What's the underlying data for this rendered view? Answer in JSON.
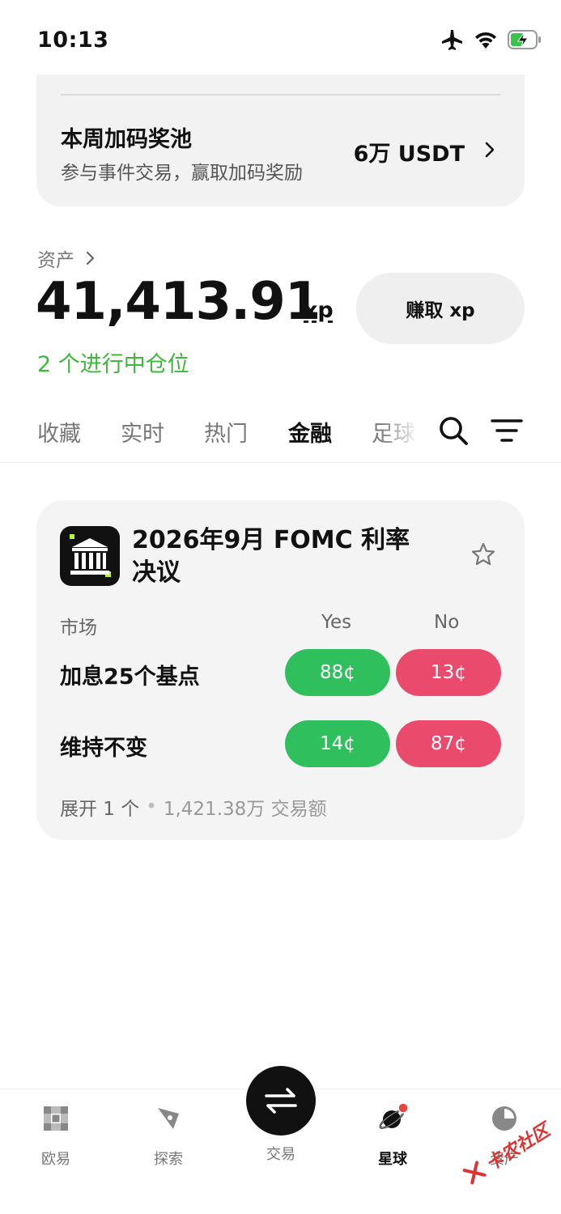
{
  "status_bar": {
    "time": "10:13"
  },
  "promo": {
    "title": "本周加码奖池",
    "subtitle": "参与事件交易，赢取加码奖励",
    "amount": "6万 USDT"
  },
  "assets": {
    "label": "资产",
    "value": "41,413.91",
    "unit": "xp",
    "earn_button": "赚取 xp",
    "positions": "2 个进行中仓位"
  },
  "tabs": [
    {
      "label": "收藏",
      "active": false
    },
    {
      "label": "实时",
      "active": false
    },
    {
      "label": "热门",
      "active": false
    },
    {
      "label": "金融",
      "active": true
    },
    {
      "label": "足球",
      "active": false
    }
  ],
  "market": {
    "title": "2026年9月 FOMC 利率决议",
    "col_market": "市场",
    "col_yes": "Yes",
    "col_no": "No",
    "rows": [
      {
        "label": "加息25个基点",
        "yes": "88¢",
        "no": "13¢"
      },
      {
        "label": "维持不变",
        "yes": "14¢",
        "no": "87¢"
      }
    ],
    "expand": "展开 1 个",
    "volume": "1,421.38万 交易额"
  },
  "bottom_nav": {
    "items": [
      {
        "label": "欧易",
        "icon": "okx-logo-icon"
      },
      {
        "label": "探索",
        "icon": "compass-icon"
      },
      {
        "label": "交易",
        "icon": "swap-arrows-icon"
      },
      {
        "label": "星球",
        "icon": "planet-icon",
        "active": true
      },
      {
        "label": "资产",
        "icon": "pie-chart-icon"
      }
    ]
  },
  "watermark": {
    "text": "卡农社区"
  },
  "colors": {
    "green": "#2fbf5d",
    "red": "#ea4a6b",
    "positions_green": "#3db83a"
  }
}
